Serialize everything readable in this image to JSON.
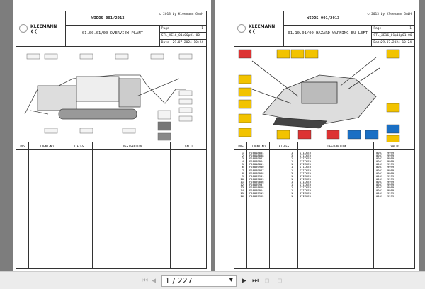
{
  "pages": [
    {
      "title": "WIDOS 001/2013",
      "copyright": "© 2013 by Kleemann GmbH",
      "brand": "KLEEMANN",
      "subtitle": "01.00.01/00 OVERVIEW PLANT",
      "page_label": "Page",
      "page_value": "1",
      "doc_id": "STL_XE16_01p00p01-00",
      "date_label": "Date",
      "date_value": "29.07.2024  10:24",
      "columns": [
        "POS",
        "IDENT-NO",
        "PIECES",
        "DESIGNATION",
        "VALID"
      ],
      "rows": []
    },
    {
      "title": "WIDOS 001/2013",
      "copyright": "© 2013 by Kleemann GmbH",
      "brand": "KLEEMANN",
      "subtitle": "01.10.01/00 HAZARD WARNING EU LEFT",
      "page_label": "Page",
      "page_value": "1",
      "doc_id": "STL_XE16_01p10p01-00",
      "date_label": "Date",
      "date_value": "29.07.2024  10:24",
      "columns": [
        "POS",
        "IDENT-NO",
        "PIECES",
        "DESIGNATION",
        "VALID"
      ],
      "rows": [
        {
          "pos": "1",
          "ident": "F28818884",
          "pieces": "1",
          "des": "STICKER",
          "valid": "0001 - 9999"
        },
        {
          "pos": "2",
          "ident": "F28818838",
          "pieces": "3",
          "des": "STICKER",
          "valid": "0001 - 9999"
        },
        {
          "pos": "3",
          "ident": "F28889941",
          "pieces": "1",
          "des": "STICKER",
          "valid": "0001 - 9999"
        },
        {
          "pos": "4",
          "ident": "F28889964",
          "pieces": "1",
          "des": "STICKER",
          "valid": "0001 - 9999"
        },
        {
          "pos": "5",
          "ident": "F28818811",
          "pieces": "1",
          "des": "STICKER",
          "valid": "0001 - 9999"
        },
        {
          "pos": "6",
          "ident": "F28889980",
          "pieces": "1",
          "des": "STICKER",
          "valid": "0001 - 9999"
        },
        {
          "pos": "7",
          "ident": "F28889987",
          "pieces": "1",
          "des": "STICKER",
          "valid": "0001 - 9999"
        },
        {
          "pos": "8",
          "ident": "F28889988",
          "pieces": "3",
          "des": "STICKER",
          "valid": "0001 - 9999"
        },
        {
          "pos": "9",
          "ident": "F28889981",
          "pieces": "1",
          "des": "STICKER",
          "valid": "0001 - 9999"
        },
        {
          "pos": "10",
          "ident": "F28889833",
          "pieces": "1",
          "des": "STICKER",
          "valid": "0001 - 9999"
        },
        {
          "pos": "11",
          "ident": "F28889886",
          "pieces": "1",
          "des": "STICKER",
          "valid": "0001 - 9999"
        },
        {
          "pos": "12",
          "ident": "F28889937",
          "pieces": "1",
          "des": "STICKER",
          "valid": "0001 - 9999"
        },
        {
          "pos": "13",
          "ident": "F28818888",
          "pieces": "1",
          "des": "STICKER",
          "valid": "0001 - 9999"
        },
        {
          "pos": "14",
          "ident": "F28889914",
          "pieces": "1",
          "des": "STICKER",
          "valid": "0001 - 9999"
        },
        {
          "pos": "15",
          "ident": "F28889919",
          "pieces": "1",
          "des": "STICKER",
          "valid": "0001 - 9999"
        },
        {
          "pos": "16",
          "ident": "F28889992",
          "pieces": "1",
          "des": "STICKER",
          "valid": "0001 - 9999"
        }
      ]
    }
  ],
  "toolbar": {
    "page_input": "1 / 227"
  }
}
